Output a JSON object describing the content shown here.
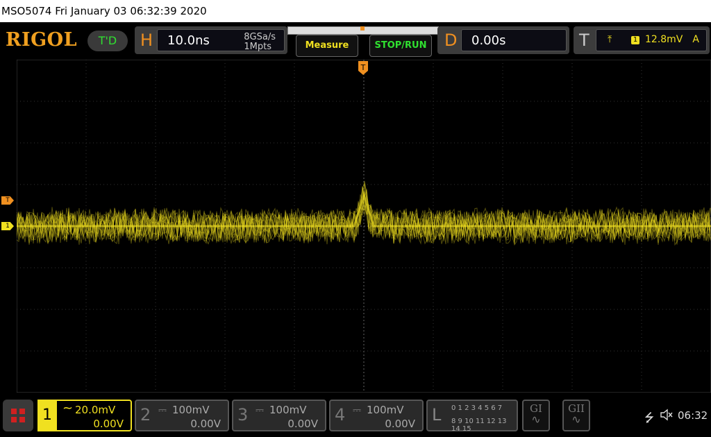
{
  "titlebar": {
    "text": "MSO5074  Fri January 03 06:32:39 2020"
  },
  "logo": "RIGOL",
  "td_button": "T'D",
  "horizontal": {
    "letter": "H",
    "timebase": "10.0ns",
    "sample_rate": "8GSa/s",
    "memory_depth": "1Mpts"
  },
  "buttons": {
    "measure": "Measure",
    "stop_run": "STOP/RUN"
  },
  "delay": {
    "letter": "D",
    "value": "0.00s"
  },
  "trigger": {
    "letter": "T",
    "source": "1",
    "level": "12.8mV",
    "mode": "A"
  },
  "markers": {
    "trigger_top": "T",
    "trigger_level": "T",
    "channel1": "1"
  },
  "channels": [
    {
      "num": "1",
      "coupling": "~",
      "scale": "20.0mV",
      "offset": "0.00V",
      "active": true,
      "color": "#f0e020"
    },
    {
      "num": "2",
      "coupling": "⎓",
      "scale": "100mV",
      "offset": "0.00V",
      "active": false
    },
    {
      "num": "3",
      "coupling": "⎓",
      "scale": "100mV",
      "offset": "0.00V",
      "active": false
    },
    {
      "num": "4",
      "coupling": "⎓",
      "scale": "100mV",
      "offset": "0.00V",
      "active": false
    }
  ],
  "logic": {
    "letter": "L",
    "row1": "0 1 2 3  4 5 6 7",
    "row2": "8 9 10 11  12 13 14 15"
  },
  "generators": [
    {
      "label": "GI"
    },
    {
      "label": "GII"
    }
  ],
  "status": {
    "time": "06:32"
  },
  "colors": {
    "ch1": "#f0e020",
    "accent": "#f09020",
    "run": "#30e030"
  },
  "icons": {
    "menu": "grid-menu-icon",
    "usb": "usb-icon",
    "speaker": "speaker-mute-icon",
    "trigger_edge": "rising-edge-icon"
  }
}
